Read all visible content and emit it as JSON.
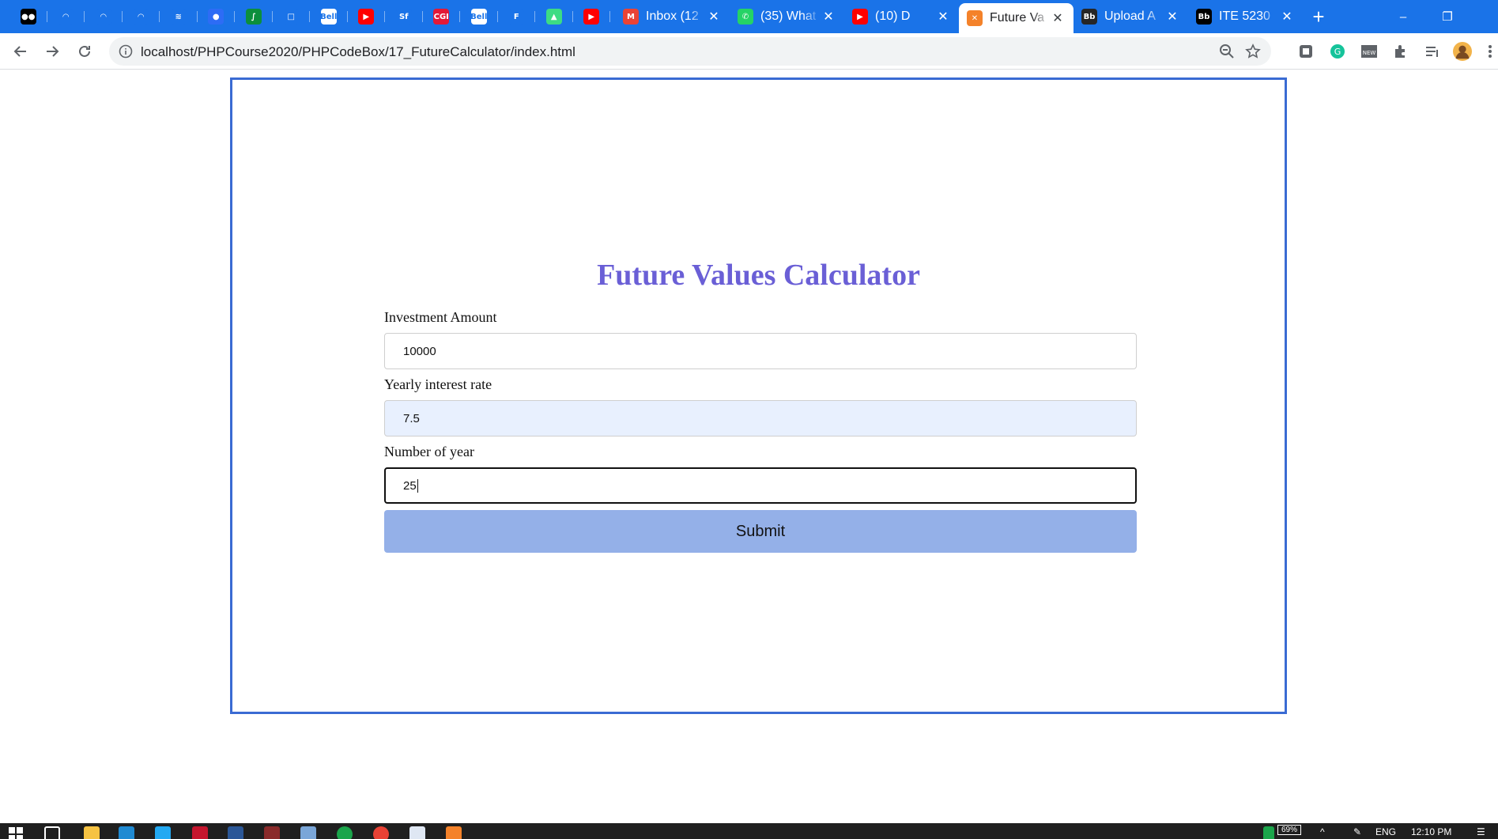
{
  "browser": {
    "pinned_tabs": [
      {
        "icon": "medium-icon",
        "glyph": "●●",
        "bg": "#000000"
      },
      {
        "icon": "weather-icon",
        "glyph": "◠",
        "bg": "#1a73e8"
      },
      {
        "icon": "weather-icon",
        "glyph": "◠",
        "bg": "#1a73e8"
      },
      {
        "icon": "weather-icon",
        "glyph": "◠",
        "bg": "#1a73e8"
      },
      {
        "icon": "drive-icon",
        "glyph": "≋",
        "bg": "#1a73e8"
      },
      {
        "icon": "messenger-icon",
        "glyph": "●",
        "bg": "#2d6cf5"
      },
      {
        "icon": "streamlabs-icon",
        "glyph": "∫",
        "bg": "#0c8f3c"
      },
      {
        "icon": "square-icon",
        "glyph": "□",
        "bg": "#1a73e8"
      },
      {
        "icon": "bell-icon",
        "glyph": "Bell",
        "bg": "#ffffff"
      },
      {
        "icon": "youtube-icon",
        "glyph": "▶",
        "bg": "#ff0000"
      },
      {
        "icon": "sf-icon",
        "glyph": "Sf",
        "bg": "#1a73e8"
      },
      {
        "icon": "cgi-icon",
        "glyph": "CGI",
        "bg": "#e31937"
      },
      {
        "icon": "bell-icon",
        "glyph": "Bell",
        "bg": "#ffffff"
      },
      {
        "icon": "f-icon",
        "glyph": "F",
        "bg": "#1a73e8"
      },
      {
        "icon": "android-icon",
        "glyph": "▲",
        "bg": "#3ddc84"
      },
      {
        "icon": "youtube-icon",
        "glyph": "▶",
        "bg": "#ff0000"
      }
    ],
    "tabs": [
      {
        "title": "Inbox (12",
        "icon": "gmail-icon",
        "glyph": "M",
        "bg": "#ea4335"
      },
      {
        "title": "(35) What",
        "icon": "whatsapp-icon",
        "glyph": "✆",
        "bg": "#25d366"
      },
      {
        "title": "(10) D",
        "icon": "youtube-icon",
        "glyph": "▶",
        "bg": "#ff0000"
      },
      {
        "title": "Future Va",
        "icon": "xampp-icon",
        "glyph": "✕",
        "bg": "#f4822a"
      },
      {
        "title": "Upload A",
        "icon": "blackboard-icon",
        "glyph": "Bb",
        "bg": "#262626"
      },
      {
        "title": "ITE 5230",
        "icon": "blackboard-icon",
        "glyph": "Bb",
        "bg": "#000000"
      }
    ],
    "address": "localhost/PHPCourse2020/PHPCodeBox/17_FutureCalculator/index.html"
  },
  "page": {
    "title": "Future Values Calculator",
    "fields": [
      {
        "label": "Investment Amount",
        "value": "10000"
      },
      {
        "label": "Yearly interest rate",
        "value": "7.5"
      },
      {
        "label": "Number of year",
        "value": "25"
      }
    ],
    "submit_label": "Submit"
  },
  "taskbar": {
    "battery": "69%",
    "language": "ENG",
    "time": "12:10 PM"
  },
  "colors": {
    "title": "#6a5fd6",
    "frame_border": "#3a6bd3",
    "submit_bg": "#94b0e8",
    "tabbar": "#1a73e8"
  }
}
